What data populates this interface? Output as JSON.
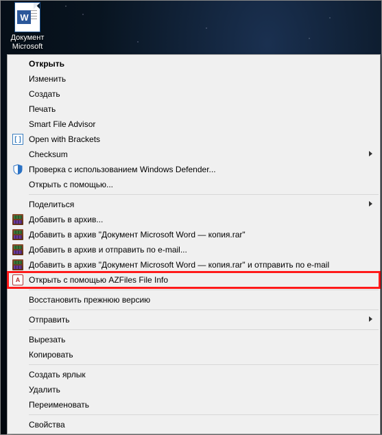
{
  "desktop": {
    "icon_label_line1": "Документ",
    "icon_label_line2": "Microsoft",
    "doc_letter": "W"
  },
  "menu": {
    "open": "Открыть",
    "edit": "Изменить",
    "create": "Создать",
    "print": "Печать",
    "smart_file_advisor": "Smart File Advisor",
    "open_with_brackets": "Open with Brackets",
    "checksum": "Checksum",
    "defender_scan": "Проверка с использованием Windows Defender...",
    "open_with": "Открыть с помощью...",
    "share": "Поделиться",
    "add_to_archive": "Добавить в архив...",
    "add_to_archive_named": "Добавить в архив \"Документ Microsoft Word — копия.rar\"",
    "archive_and_email": "Добавить в архив и отправить по e-mail...",
    "archive_named_and_email": "Добавить в архив \"Документ Microsoft Word — копия.rar\" и отправить по e-mail",
    "azfiles_open": "Открыть с помощью AZFiles File Info",
    "restore_previous": "Восстановить прежнюю версию",
    "send_to": "Отправить",
    "cut": "Вырезать",
    "copy": "Копировать",
    "create_shortcut": "Создать ярлык",
    "delete": "Удалить",
    "rename": "Переименовать",
    "properties": "Свойства"
  }
}
